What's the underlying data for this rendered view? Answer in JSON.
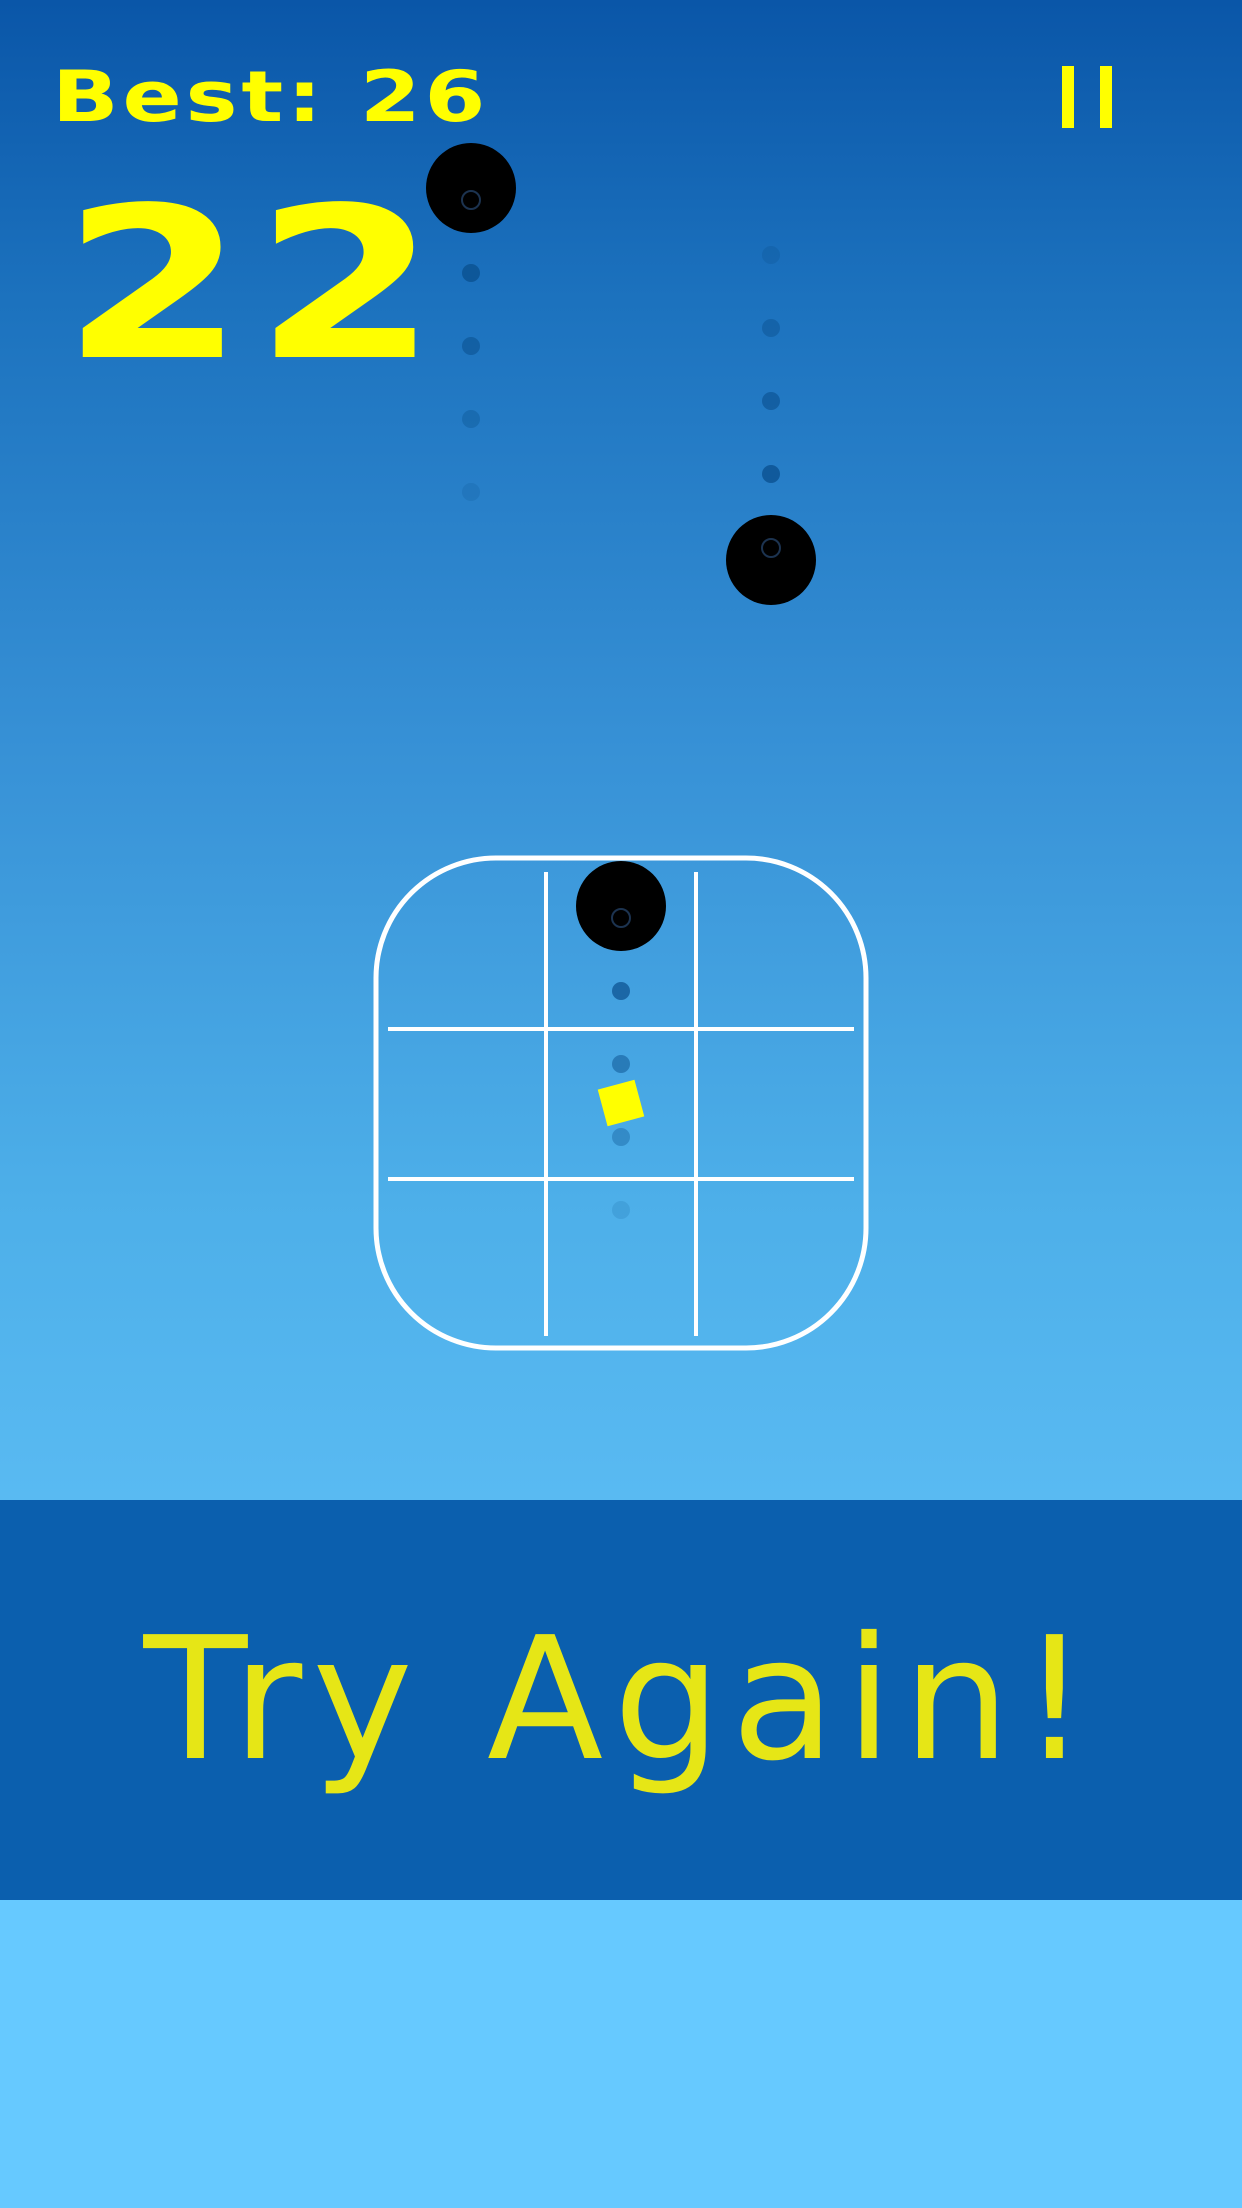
{
  "hud": {
    "best_label": "Best: 26",
    "score": "22"
  },
  "banner": {
    "label": "Try Again!"
  },
  "colors": {
    "accent": "#ffff00",
    "banner_bg": "#0b5fae",
    "banner_text": "#e6e616",
    "ball": "#000000",
    "grid": "#ffffff"
  },
  "icons": {
    "pause": "pause-icon"
  }
}
